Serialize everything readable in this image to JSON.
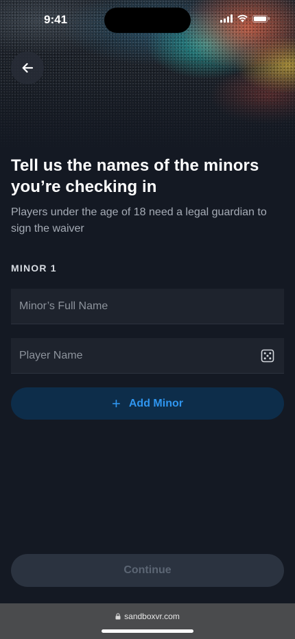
{
  "status_bar": {
    "time": "9:41"
  },
  "header": {
    "title": "Tell us the names of the minors you’re checking in",
    "subtitle": "Players under the age of 18 need a legal guardian to sign the waiver"
  },
  "form": {
    "section_label": "MINOR 1",
    "minor_name": {
      "placeholder": "Minor’s Full Name",
      "value": ""
    },
    "player_name": {
      "placeholder": "Player Name",
      "value": ""
    },
    "add_minor_label": "Add Minor",
    "continue_label": "Continue"
  },
  "browser": {
    "url": "sandboxvr.com"
  },
  "colors": {
    "background": "#141923",
    "field": "#1e232d",
    "accent": "#2f96f0",
    "add_button_bg": "#0d2d4a",
    "disabled_button_bg": "#2b3340",
    "disabled_text": "#5c6674"
  },
  "icons": {
    "back": "arrow-left-icon",
    "randomize": "dice-icon",
    "add": "plus-icon",
    "secure": "lock-icon",
    "wifi": "wifi-icon",
    "signal": "cellular-signal-icon",
    "battery": "battery-icon"
  }
}
